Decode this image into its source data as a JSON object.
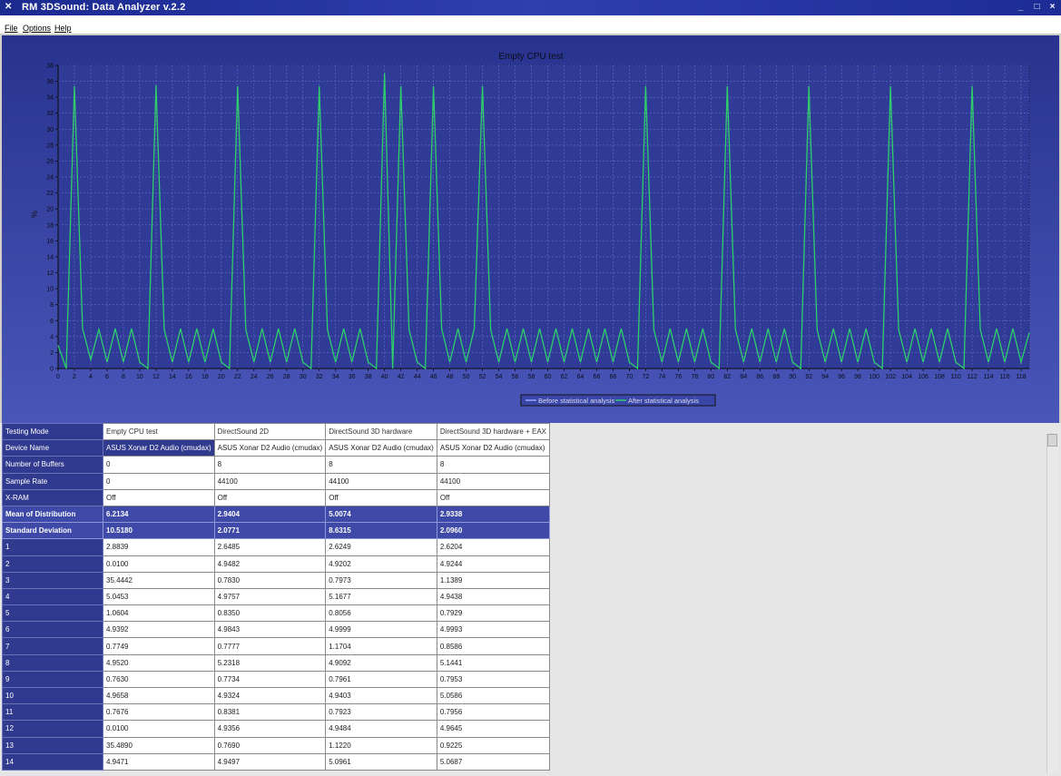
{
  "window": {
    "title": "RM 3DSound: Data Analyzer  v.2.2",
    "app_icon": "x-logo-icon",
    "controls": {
      "minimize": "_",
      "maximize": "□",
      "close": "×"
    }
  },
  "menu": [
    {
      "label": "File"
    },
    {
      "label": "Options"
    },
    {
      "label": "Help"
    }
  ],
  "chart_data": {
    "type": "line",
    "title": "Empty CPU test",
    "ylabel": "%",
    "xlabel": "",
    "ylim": [
      0,
      38
    ],
    "xlim": [
      0,
      119
    ],
    "grid": true,
    "legend_position": "bottom-center",
    "yticks": [
      0,
      2,
      4,
      6,
      8,
      10,
      12,
      14,
      16,
      18,
      20,
      22,
      24,
      26,
      28,
      30,
      32,
      34,
      36,
      38
    ],
    "xticks": [
      0,
      2,
      4,
      6,
      8,
      10,
      12,
      14,
      16,
      18,
      20,
      22,
      24,
      26,
      28,
      30,
      32,
      34,
      36,
      38,
      40,
      42,
      44,
      46,
      48,
      50,
      52,
      54,
      56,
      58,
      60,
      62,
      64,
      66,
      68,
      70,
      72,
      74,
      76,
      78,
      80,
      82,
      84,
      86,
      88,
      90,
      92,
      94,
      96,
      98,
      100,
      102,
      104,
      106,
      108,
      110,
      112,
      114,
      116,
      118
    ],
    "colors": {
      "before": "#9aa4ff",
      "after": "#2ecf6a",
      "background_top": "#28338f",
      "background_bottom": "#4a56b8",
      "plot_bg": "#303b97",
      "grid": "#6670c4",
      "axis": "#0a0a0a"
    },
    "series": [
      {
        "name": "Before statistical analysis",
        "values": []
      },
      {
        "name": "After statistical analysis",
        "values": [
          2.9,
          0.0,
          35.4,
          5.0,
          1.1,
          4.9,
          0.8,
          5.0,
          0.8,
          5.0,
          0.8,
          0.0,
          35.5,
          4.9,
          0.8,
          5.0,
          0.8,
          5.0,
          0.8,
          5.0,
          0.8,
          0.0,
          35.4,
          4.9,
          0.8,
          5.0,
          0.8,
          5.0,
          0.8,
          5.0,
          0.8,
          0.0,
          35.4,
          4.9,
          0.8,
          5.0,
          0.8,
          5.0,
          0.8,
          0.0,
          37.0,
          0.0,
          35.4,
          4.9,
          0.8,
          0.0,
          35.4,
          5.0,
          0.8,
          5.0,
          0.8,
          5.0,
          35.4,
          4.9,
          0.8,
          5.0,
          0.8,
          5.0,
          0.8,
          5.0,
          0.8,
          5.0,
          0.8,
          5.0,
          0.8,
          5.0,
          0.8,
          5.0,
          0.8,
          5.0,
          0.8,
          0.0,
          35.4,
          4.9,
          0.8,
          5.0,
          0.8,
          5.0,
          0.8,
          5.0,
          0.8,
          0.0,
          35.4,
          4.9,
          0.8,
          5.0,
          0.8,
          5.0,
          0.8,
          5.0,
          0.8,
          0.0,
          35.4,
          4.9,
          0.8,
          5.0,
          0.8,
          5.0,
          0.8,
          5.0,
          0.8,
          0.0,
          35.4,
          4.9,
          0.8,
          5.0,
          0.8,
          5.0,
          0.8,
          5.0,
          0.8,
          0.0,
          35.4,
          4.9,
          0.8,
          5.0,
          0.8,
          5.0,
          0.8,
          4.5
        ]
      }
    ]
  },
  "table": {
    "columns": [
      "Empty CPU test",
      "DirectSound 2D",
      "DirectSound 3D hardware",
      "DirectSound 3D hardware + EAX"
    ],
    "rows": [
      {
        "label": "Testing Mode",
        "kind": "header",
        "cells": [
          "Empty CPU test",
          "DirectSound 2D",
          "DirectSound 3D hardware",
          "DirectSound 3D hardware + EAX"
        ]
      },
      {
        "label": "Device Name",
        "kind": "device",
        "cells": [
          "ASUS Xonar D2 Audio (cmudax)",
          "ASUS Xonar D2 Audio (cmudax)",
          "ASUS Xonar D2 Audio (cmudax)",
          "ASUS Xonar D2 Audio (cmudax)"
        ]
      },
      {
        "label": "Number of Buffers",
        "kind": "plain",
        "cells": [
          "0",
          "8",
          "8",
          "8"
        ]
      },
      {
        "label": "Sample Rate",
        "kind": "plain",
        "cells": [
          "0",
          "44100",
          "44100",
          "44100"
        ]
      },
      {
        "label": "X-RAM",
        "kind": "plain",
        "cells": [
          "Off",
          "Off",
          "Off",
          "Off"
        ]
      },
      {
        "label": "Mean of Distribution",
        "kind": "stat",
        "cells": [
          "6.2134",
          "2.9404",
          "5.0074",
          "2.9338"
        ]
      },
      {
        "label": "Standard Deviation",
        "kind": "stat",
        "cells": [
          "10.5180",
          "2.0771",
          "8.6315",
          "2.0960"
        ]
      },
      {
        "label": "1",
        "kind": "plain",
        "cells": [
          "2.8839",
          "2.6485",
          "2.6249",
          "2.6204"
        ]
      },
      {
        "label": "2",
        "kind": "plain",
        "cells": [
          "0.0100",
          "4.9482",
          "4.9202",
          "4.9244"
        ]
      },
      {
        "label": "3",
        "kind": "plain",
        "cells": [
          "35.4442",
          "0.7830",
          "0.7973",
          "1.1389"
        ]
      },
      {
        "label": "4",
        "kind": "plain",
        "cells": [
          "5.0453",
          "4.9757",
          "5.1677",
          "4.9438"
        ]
      },
      {
        "label": "5",
        "kind": "plain",
        "cells": [
          "1.0604",
          "0.8350",
          "0.8056",
          "0.7929"
        ]
      },
      {
        "label": "6",
        "kind": "plain",
        "cells": [
          "4.9392",
          "4.9843",
          "4.9999",
          "4.9993"
        ]
      },
      {
        "label": "7",
        "kind": "plain",
        "cells": [
          "0.7749",
          "0.7777",
          "1.1704",
          "0.8586"
        ]
      },
      {
        "label": "8",
        "kind": "plain",
        "cells": [
          "4.9520",
          "5.2318",
          "4.9092",
          "5.1441"
        ]
      },
      {
        "label": "9",
        "kind": "plain",
        "cells": [
          "0.7630",
          "0.7734",
          "0.7961",
          "0.7953"
        ]
      },
      {
        "label": "10",
        "kind": "plain",
        "cells": [
          "4.9658",
          "4.9324",
          "4.9403",
          "5.0586"
        ]
      },
      {
        "label": "11",
        "kind": "plain",
        "cells": [
          "0.7676",
          "0.8381",
          "0.7923",
          "0.7956"
        ]
      },
      {
        "label": "12",
        "kind": "plain",
        "cells": [
          "0.0100",
          "4.9356",
          "4.9484",
          "4.9645"
        ]
      },
      {
        "label": "13",
        "kind": "plain",
        "cells": [
          "35.4890",
          "0.7690",
          "1.1220",
          "0.9225"
        ]
      },
      {
        "label": "14",
        "kind": "plain",
        "cells": [
          "4.9471",
          "4.9497",
          "5.0961",
          "5.0687"
        ]
      }
    ]
  }
}
